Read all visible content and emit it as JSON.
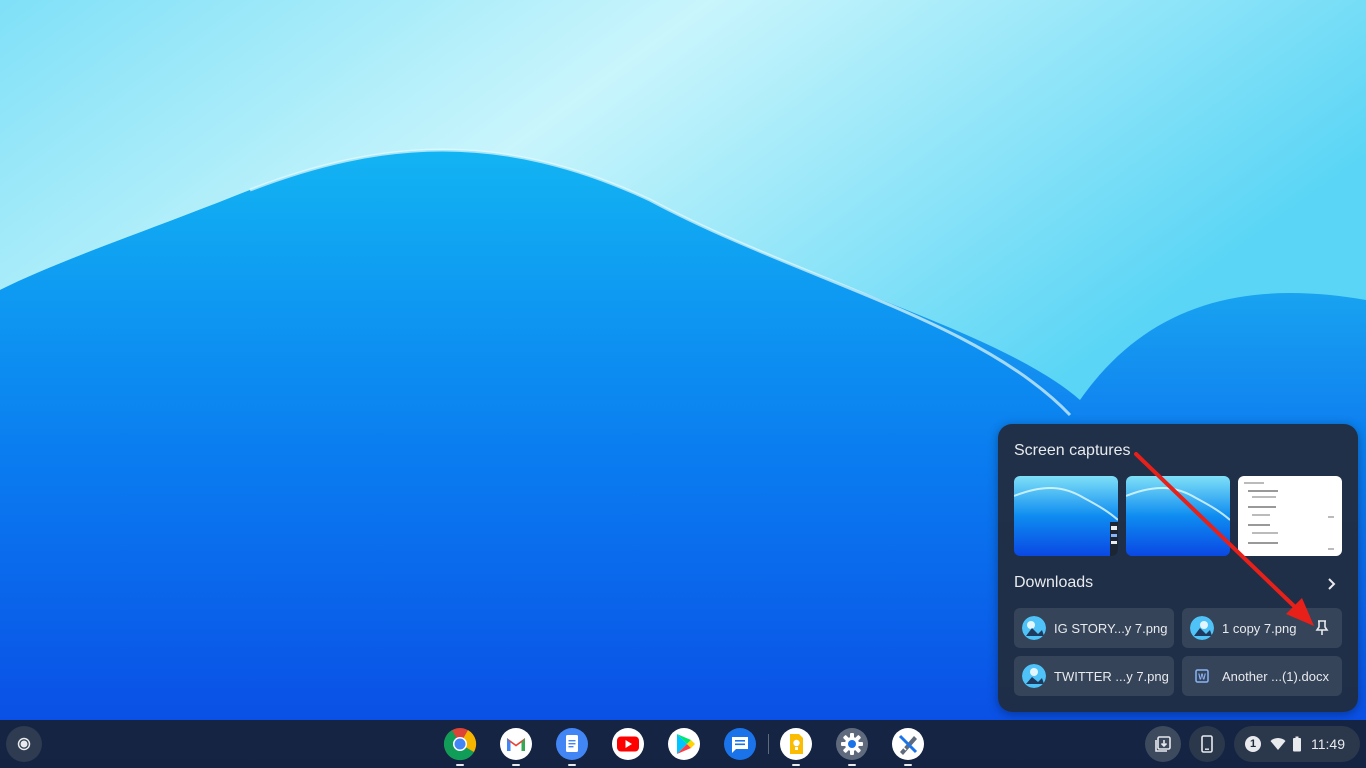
{
  "holding_space": {
    "screen_captures": {
      "title": "Screen captures",
      "items": [
        {
          "kind": "wallpaper-with-phone-thumbnail"
        },
        {
          "kind": "wallpaper-thumbnail"
        },
        {
          "kind": "document-thumbnail"
        }
      ]
    },
    "downloads": {
      "title": "Downloads",
      "items": [
        {
          "label": "IG STORY...y 7.png",
          "icon": "image-file-icon"
        },
        {
          "label": "1 copy 7.png",
          "icon": "image-file-icon",
          "action_icon": "pin-icon"
        },
        {
          "label": "TWITTER ...y 7.png",
          "icon": "image-file-icon"
        },
        {
          "label": "Another ...(1).docx",
          "icon": "word-doc-icon"
        }
      ]
    }
  },
  "shelf": {
    "apps": [
      {
        "name": "Chrome",
        "icon": "chrome-icon"
      },
      {
        "name": "Gmail",
        "icon": "gmail-icon"
      },
      {
        "name": "Docs",
        "icon": "docs-icon"
      },
      {
        "name": "YouTube",
        "icon": "youtube-icon"
      },
      {
        "name": "Play Store",
        "icon": "play-store-icon"
      },
      {
        "name": "Messages",
        "icon": "messages-icon"
      },
      {
        "name": "Keep",
        "icon": "keep-icon"
      },
      {
        "name": "Settings",
        "icon": "settings-icon"
      },
      {
        "name": "Canvas",
        "icon": "canvas-icon"
      }
    ],
    "status": {
      "notification_count": "1",
      "clock": "11:49"
    }
  },
  "colors": {
    "bubble_bg": "#202d42",
    "chip_bg": "#354459",
    "annotation_arrow": "#e8201a",
    "shelf_bg": "#162134"
  }
}
